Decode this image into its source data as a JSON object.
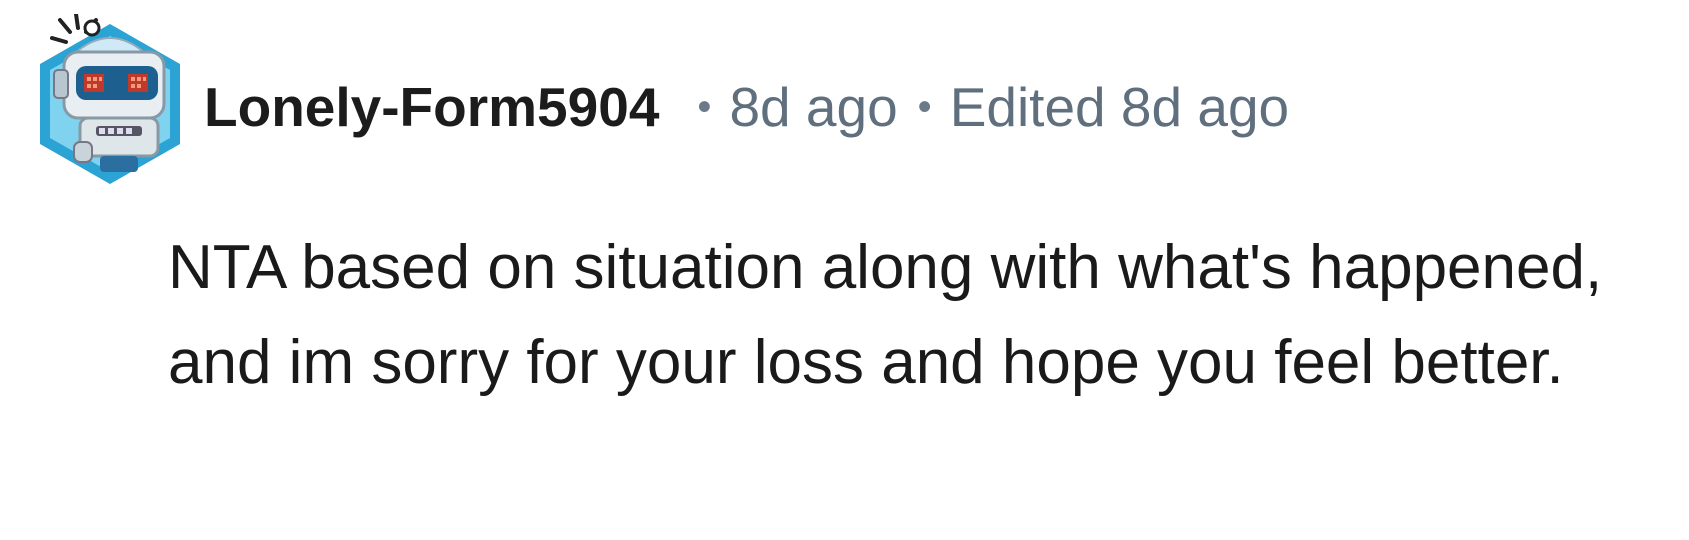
{
  "comment": {
    "author": "Lonely-Form5904",
    "avatar_icon": "robot-avatar-icon",
    "separator": "•",
    "posted": "8d ago",
    "edited": "Edited 8d ago",
    "body": "NTA based on situation along with what's happened, and im sorry for your loss and hope you feel better."
  },
  "colors": {
    "author": "#1c1c1c",
    "meta": "#5f6f7d",
    "body": "#1a1a1b",
    "avatar_bg": "#2a9fd0"
  }
}
